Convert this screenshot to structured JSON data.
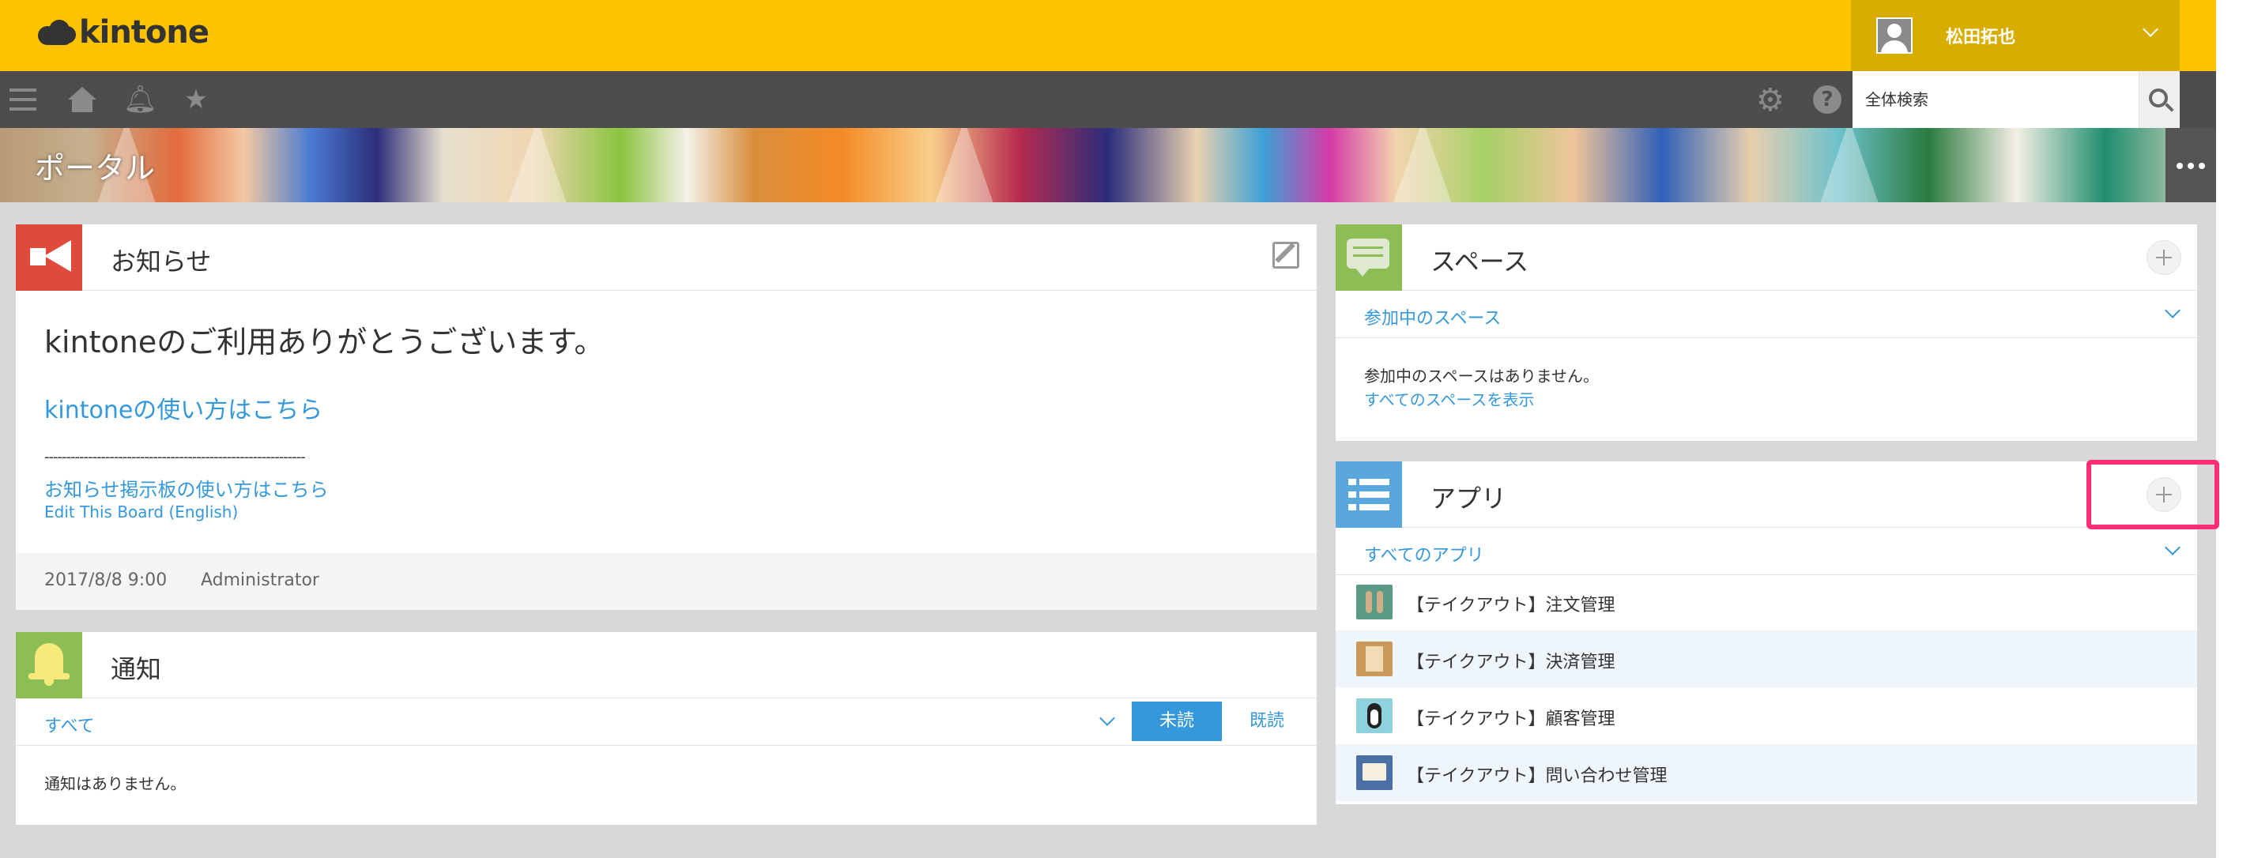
{
  "app": {
    "logo_text": "kintone"
  },
  "user": {
    "name": "松田拓也"
  },
  "search": {
    "placeholder": "全体検索"
  },
  "banner": {
    "title": "ポータル"
  },
  "notice": {
    "title": "お知らせ",
    "heading": "kintoneのご利用ありがとうございます。",
    "link_howto": "kintoneの使い方はこちら",
    "divider": "------------------------------------------------------------",
    "link_board": "お知らせ掲示板の使い方はこちら",
    "link_english": "Edit This Board (English)",
    "date": "2017/8/8 9:00",
    "author": "Administrator"
  },
  "notifications": {
    "title": "通知",
    "filter": "すべて",
    "tab_unread": "未読",
    "tab_read": "既読",
    "empty": "通知はありません。"
  },
  "spaces": {
    "title": "スペース",
    "filter": "参加中のスペース",
    "empty": "参加中のスペースはありません。",
    "show_all": "すべてのスペースを表示"
  },
  "apps": {
    "title": "アプリ",
    "filter": "すべてのアプリ",
    "items": [
      {
        "label": "【テイクアウト】注文管理",
        "icon": "cutlery-icon",
        "color": "#5a9a86"
      },
      {
        "label": "【テイクアウト】決済管理",
        "icon": "receipt-icon",
        "color": "#c99a5b"
      },
      {
        "label": "【テイクアウト】顧客管理",
        "icon": "penguin-icon",
        "color": "#8fd2de"
      },
      {
        "label": "【テイクアウト】問い合わせ管理",
        "icon": "message-icon",
        "color": "#4a6fa5"
      }
    ]
  },
  "colors": {
    "header": "#fdc200",
    "nav": "#4d4d4d",
    "link": "#3498db",
    "notice_icon": "#e04a3a",
    "notification_icon": "#8dbd55",
    "space_icon": "#8dbd55",
    "app_icon": "#5aa7de",
    "highlight": "#ff2e75"
  }
}
